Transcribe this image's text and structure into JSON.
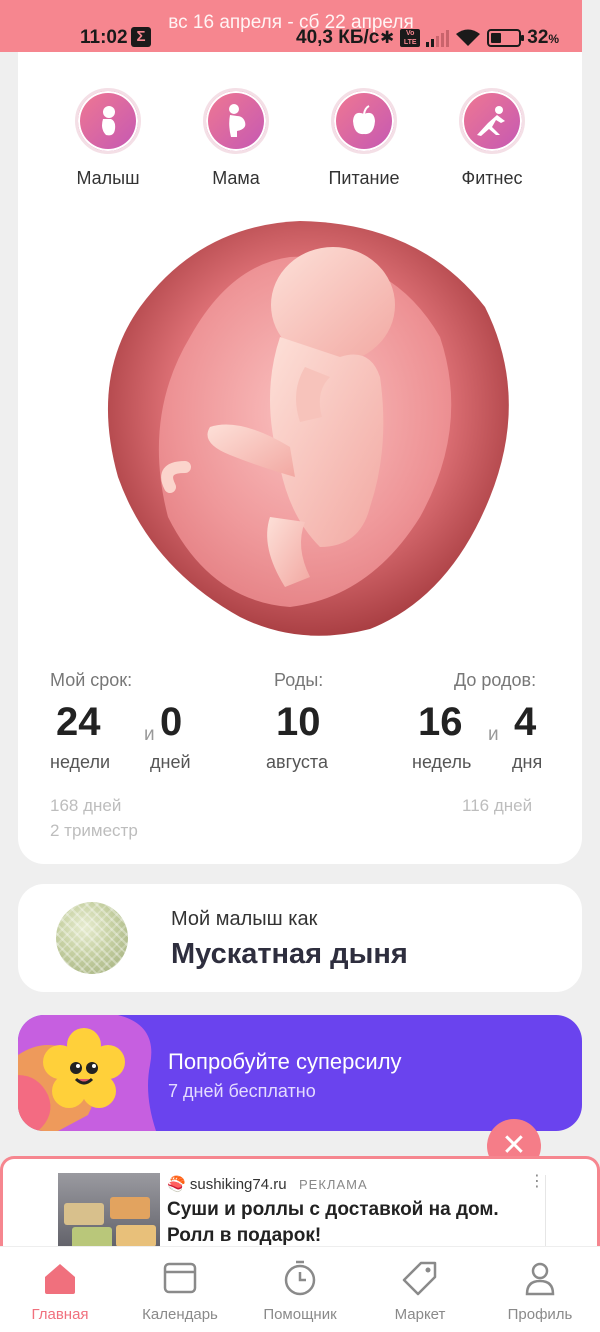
{
  "status_bar": {
    "week_range": "вс 16 апреля - сб 22 апреля",
    "time": "11:02",
    "net_speed": "40,3 КБ/с",
    "battery": "32",
    "battery_unit": "%"
  },
  "categories": [
    {
      "label": "Малыш",
      "icon": "baby-icon"
    },
    {
      "label": "Мама",
      "icon": "pregnant-icon"
    },
    {
      "label": "Питание",
      "icon": "apple-icon"
    },
    {
      "label": "Фитнес",
      "icon": "fitness-icon"
    }
  ],
  "term": {
    "caption": "Мой срок:",
    "weeks": "24",
    "conj": "и",
    "days": "0",
    "weeks_unit": "недели",
    "days_unit": "дней",
    "total_days": "168 дней",
    "trimester": "2 триместр"
  },
  "birth": {
    "caption": "Роды:",
    "day": "10",
    "month": "августа"
  },
  "remaining": {
    "caption": "До родов:",
    "weeks": "16",
    "conj": "и",
    "days": "4",
    "weeks_unit": "недель",
    "days_unit": "дня",
    "total_days": "116 дней"
  },
  "fruit": {
    "line1": "Мой малыш как",
    "name": "Мускатная дыня"
  },
  "promo": {
    "title": "Попробуйте суперсилу",
    "subtitle": "7 дней бесплатно",
    "close": "✕"
  },
  "ad": {
    "site": "sushiking74.ru",
    "tag": "РЕКЛАМА",
    "headline": "Суши и роллы с доставкой на дом. Ролл в подарок!",
    "menu": "⋮"
  },
  "nav": [
    {
      "label": "Главная",
      "icon": "home-icon",
      "active": true
    },
    {
      "label": "Календарь",
      "icon": "calendar-icon"
    },
    {
      "label": "Помощник",
      "icon": "timer-icon"
    },
    {
      "label": "Маркет",
      "icon": "tag-icon"
    },
    {
      "label": "Профиль",
      "icon": "profile-icon"
    }
  ],
  "colors": {
    "accent": "#f6868f",
    "promo_bg": "#6a43ee",
    "active_nav": "#f0707d"
  }
}
